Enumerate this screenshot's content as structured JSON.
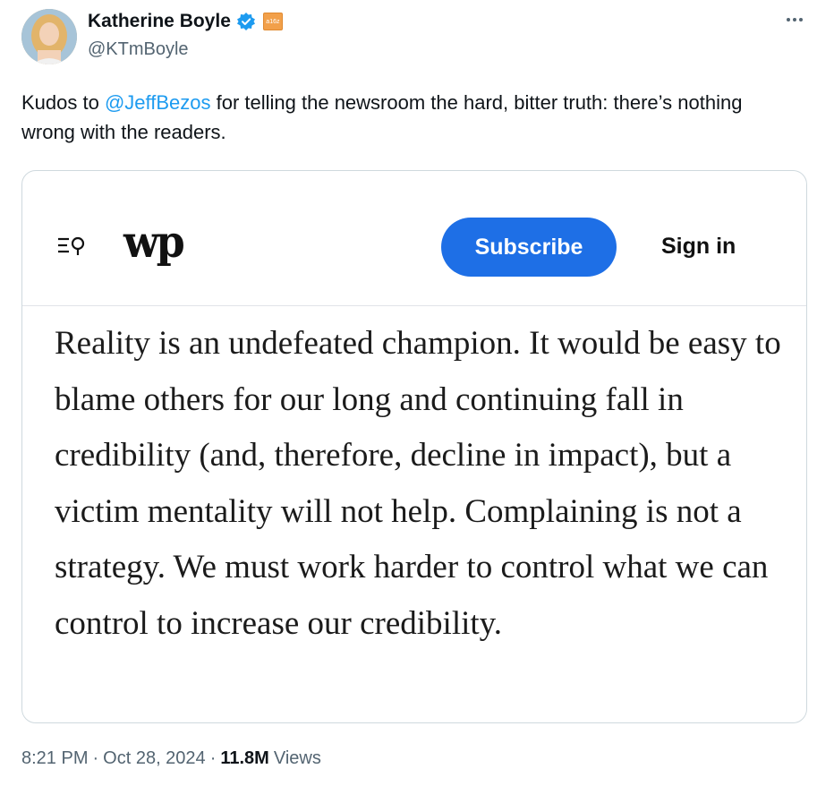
{
  "author": {
    "name": "Katherine Boyle",
    "handle": "@KTmBoyle",
    "avatar_icon": "avatar-photo",
    "verified_icon": "verified-badge-icon",
    "affiliation_badge": "a16z"
  },
  "tweet": {
    "text_before": "Kudos to ",
    "mention": "@JeffBezos",
    "text_after": " for telling the newsroom the hard, bitter truth: there’s nothing wrong with the readers."
  },
  "card": {
    "logo": "wp",
    "subscribe_label": "Subscribe",
    "signin_label": "Sign in",
    "article_text": "Reality is an undefeated champion. It would be easy to blame others for our long and continuing fall in credibility (and, therefore, decline in impact), but a victim mentality will not help. Complaining is not a strategy. We must work harder to control what we can control to increase our credibility."
  },
  "meta": {
    "time": "8:21 PM",
    "sep1": "·",
    "date": "Oct 28, 2024",
    "sep2": "·",
    "views_count": "11.8M",
    "views_label": "Views"
  },
  "colors": {
    "accent": "#1d9bf0",
    "subscribe_bg": "#1e6fe6",
    "secondary_text": "#536471"
  }
}
